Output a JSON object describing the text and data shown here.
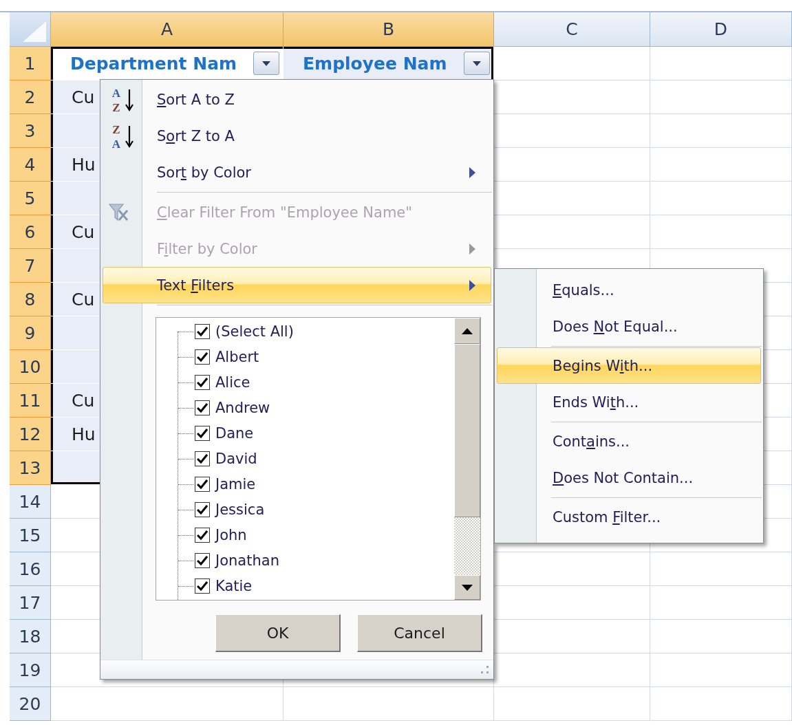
{
  "sheet": {
    "columns": [
      {
        "label": "A",
        "selected": true
      },
      {
        "label": "B",
        "selected": true
      },
      {
        "label": "C",
        "selected": false
      },
      {
        "label": "D",
        "selected": false
      }
    ],
    "rows": [
      {
        "number": "1",
        "selected": true,
        "in_table": true,
        "table_header": [
          {
            "text": "Department Nam",
            "active": true
          },
          {
            "text": "Employee Nam",
            "active": false
          }
        ]
      },
      {
        "number": "2",
        "selected": true,
        "in_table": true,
        "department": "Cu"
      },
      {
        "number": "3",
        "selected": true,
        "in_table": true
      },
      {
        "number": "4",
        "selected": true,
        "in_table": true,
        "department": "Hu"
      },
      {
        "number": "5",
        "selected": true,
        "in_table": true
      },
      {
        "number": "6",
        "selected": true,
        "in_table": true,
        "department": "Cu"
      },
      {
        "number": "7",
        "selected": true,
        "in_table": true
      },
      {
        "number": "8",
        "selected": true,
        "in_table": true,
        "department": "Cu"
      },
      {
        "number": "9",
        "selected": true,
        "in_table": true
      },
      {
        "number": "10",
        "selected": true,
        "in_table": true
      },
      {
        "number": "11",
        "selected": true,
        "in_table": true,
        "department": "Cu"
      },
      {
        "number": "12",
        "selected": true,
        "in_table": true,
        "department": "Hu"
      },
      {
        "number": "13",
        "selected": true,
        "in_table": true
      },
      {
        "number": "14",
        "selected": false,
        "in_table": false
      },
      {
        "number": "15",
        "selected": false,
        "in_table": false
      },
      {
        "number": "16",
        "selected": false,
        "in_table": false
      },
      {
        "number": "17",
        "selected": false,
        "in_table": false
      },
      {
        "number": "18",
        "selected": false,
        "in_table": false
      },
      {
        "number": "19",
        "selected": false,
        "in_table": false
      },
      {
        "number": "20",
        "selected": false,
        "in_table": false
      }
    ]
  },
  "filter_menu": {
    "items": [
      {
        "kind": "ascending",
        "icon_letters": [
          "A",
          "Z"
        ],
        "key": "S",
        "after": "ort A to Z",
        "selected": false,
        "disabled": false
      },
      {
        "kind": "descending",
        "icon_letters": [
          "Z",
          "A"
        ],
        "before": "S",
        "key": "o",
        "after": "rt Z to A",
        "selected": false,
        "disabled": false
      },
      {
        "kind": "submenu",
        "before": "Sor",
        "key": "t",
        "after": " by Color",
        "selected": false,
        "disabled": false
      },
      {
        "kind": "separator"
      },
      {
        "kind": "clear",
        "key": "C",
        "after": "lear Filter From \"Employee Name\"",
        "selected": false,
        "disabled": true
      },
      {
        "kind": "submenu",
        "before": "F",
        "key": "i",
        "after": "lter by Color",
        "selected": false,
        "disabled": true
      },
      {
        "kind": "submenu",
        "before": "Text ",
        "key": "F",
        "after": "ilters",
        "selected": true,
        "disabled": false
      },
      {
        "kind": "separator"
      }
    ],
    "values": [
      {
        "label": "(Select All)",
        "checked": true
      },
      {
        "label": "Albert",
        "checked": true
      },
      {
        "label": "Alice",
        "checked": true
      },
      {
        "label": "Andrew",
        "checked": true
      },
      {
        "label": "Dane",
        "checked": true
      },
      {
        "label": "David",
        "checked": true
      },
      {
        "label": "Jamie",
        "checked": true
      },
      {
        "label": "Jessica",
        "checked": true
      },
      {
        "label": "John",
        "checked": true
      },
      {
        "label": "Jonathan",
        "checked": true
      },
      {
        "label": "Katie",
        "checked": true
      }
    ],
    "buttons": [
      "OK",
      "Cancel"
    ]
  },
  "submenu": {
    "items": [
      {
        "kind": "command",
        "key": "E",
        "after": "quals...",
        "selected": false
      },
      {
        "kind": "command",
        "before": "Does ",
        "key": "N",
        "after": "ot Equal...",
        "selected": false
      },
      {
        "kind": "separator"
      },
      {
        "kind": "command",
        "before": "Begins W",
        "key": "i",
        "after": "th...",
        "selected": true
      },
      {
        "kind": "command",
        "before": "Ends Wi",
        "key": "t",
        "after": "h...",
        "selected": false
      },
      {
        "kind": "separator"
      },
      {
        "kind": "command",
        "before": "Cont",
        "key": "a",
        "after": "ins...",
        "selected": false
      },
      {
        "kind": "command",
        "key": "D",
        "after": "oes Not Contain...",
        "selected": false
      },
      {
        "kind": "separator"
      },
      {
        "kind": "command",
        "before": "Custom ",
        "key": "F",
        "after": "ilter...",
        "selected": false
      }
    ]
  }
}
